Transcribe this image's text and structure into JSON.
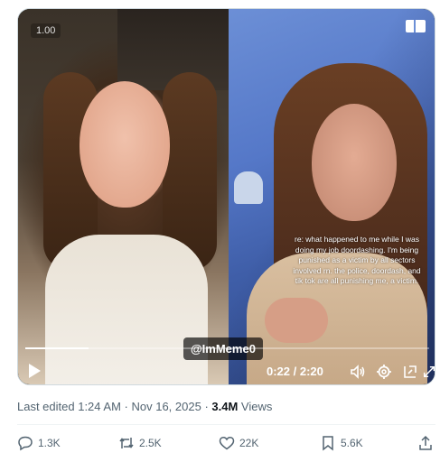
{
  "video": {
    "playback_speed": "1.00",
    "caption_text": "re: what happened to me while I was doing my job doordashing. I'm being punished as a victim by all sectors involved rn. the police, doordash, and tik tok are all punishing me, a victim.",
    "watermark": "@ImMeme0",
    "time_display": "0:22 / 2:20",
    "progress_fraction": 0.157,
    "icons": [
      "play-icon",
      "volume-icon",
      "settings-gear-icon",
      "picture-in-picture-icon",
      "fullscreen-icon",
      "layout-icon"
    ]
  },
  "meta": {
    "edited_label": "Last edited 1:24 AM",
    "separator": " · ",
    "date": "Nov 16, 2025",
    "views_count": "3.4M",
    "views_label": " Views"
  },
  "actions": {
    "replies": "1.3K",
    "reposts": "2.5K",
    "likes": "22K",
    "bookmarks": "5.6K"
  },
  "colors": {
    "text_primary": "#0f1419",
    "text_secondary": "#536471",
    "divider": "#eff3f4"
  }
}
